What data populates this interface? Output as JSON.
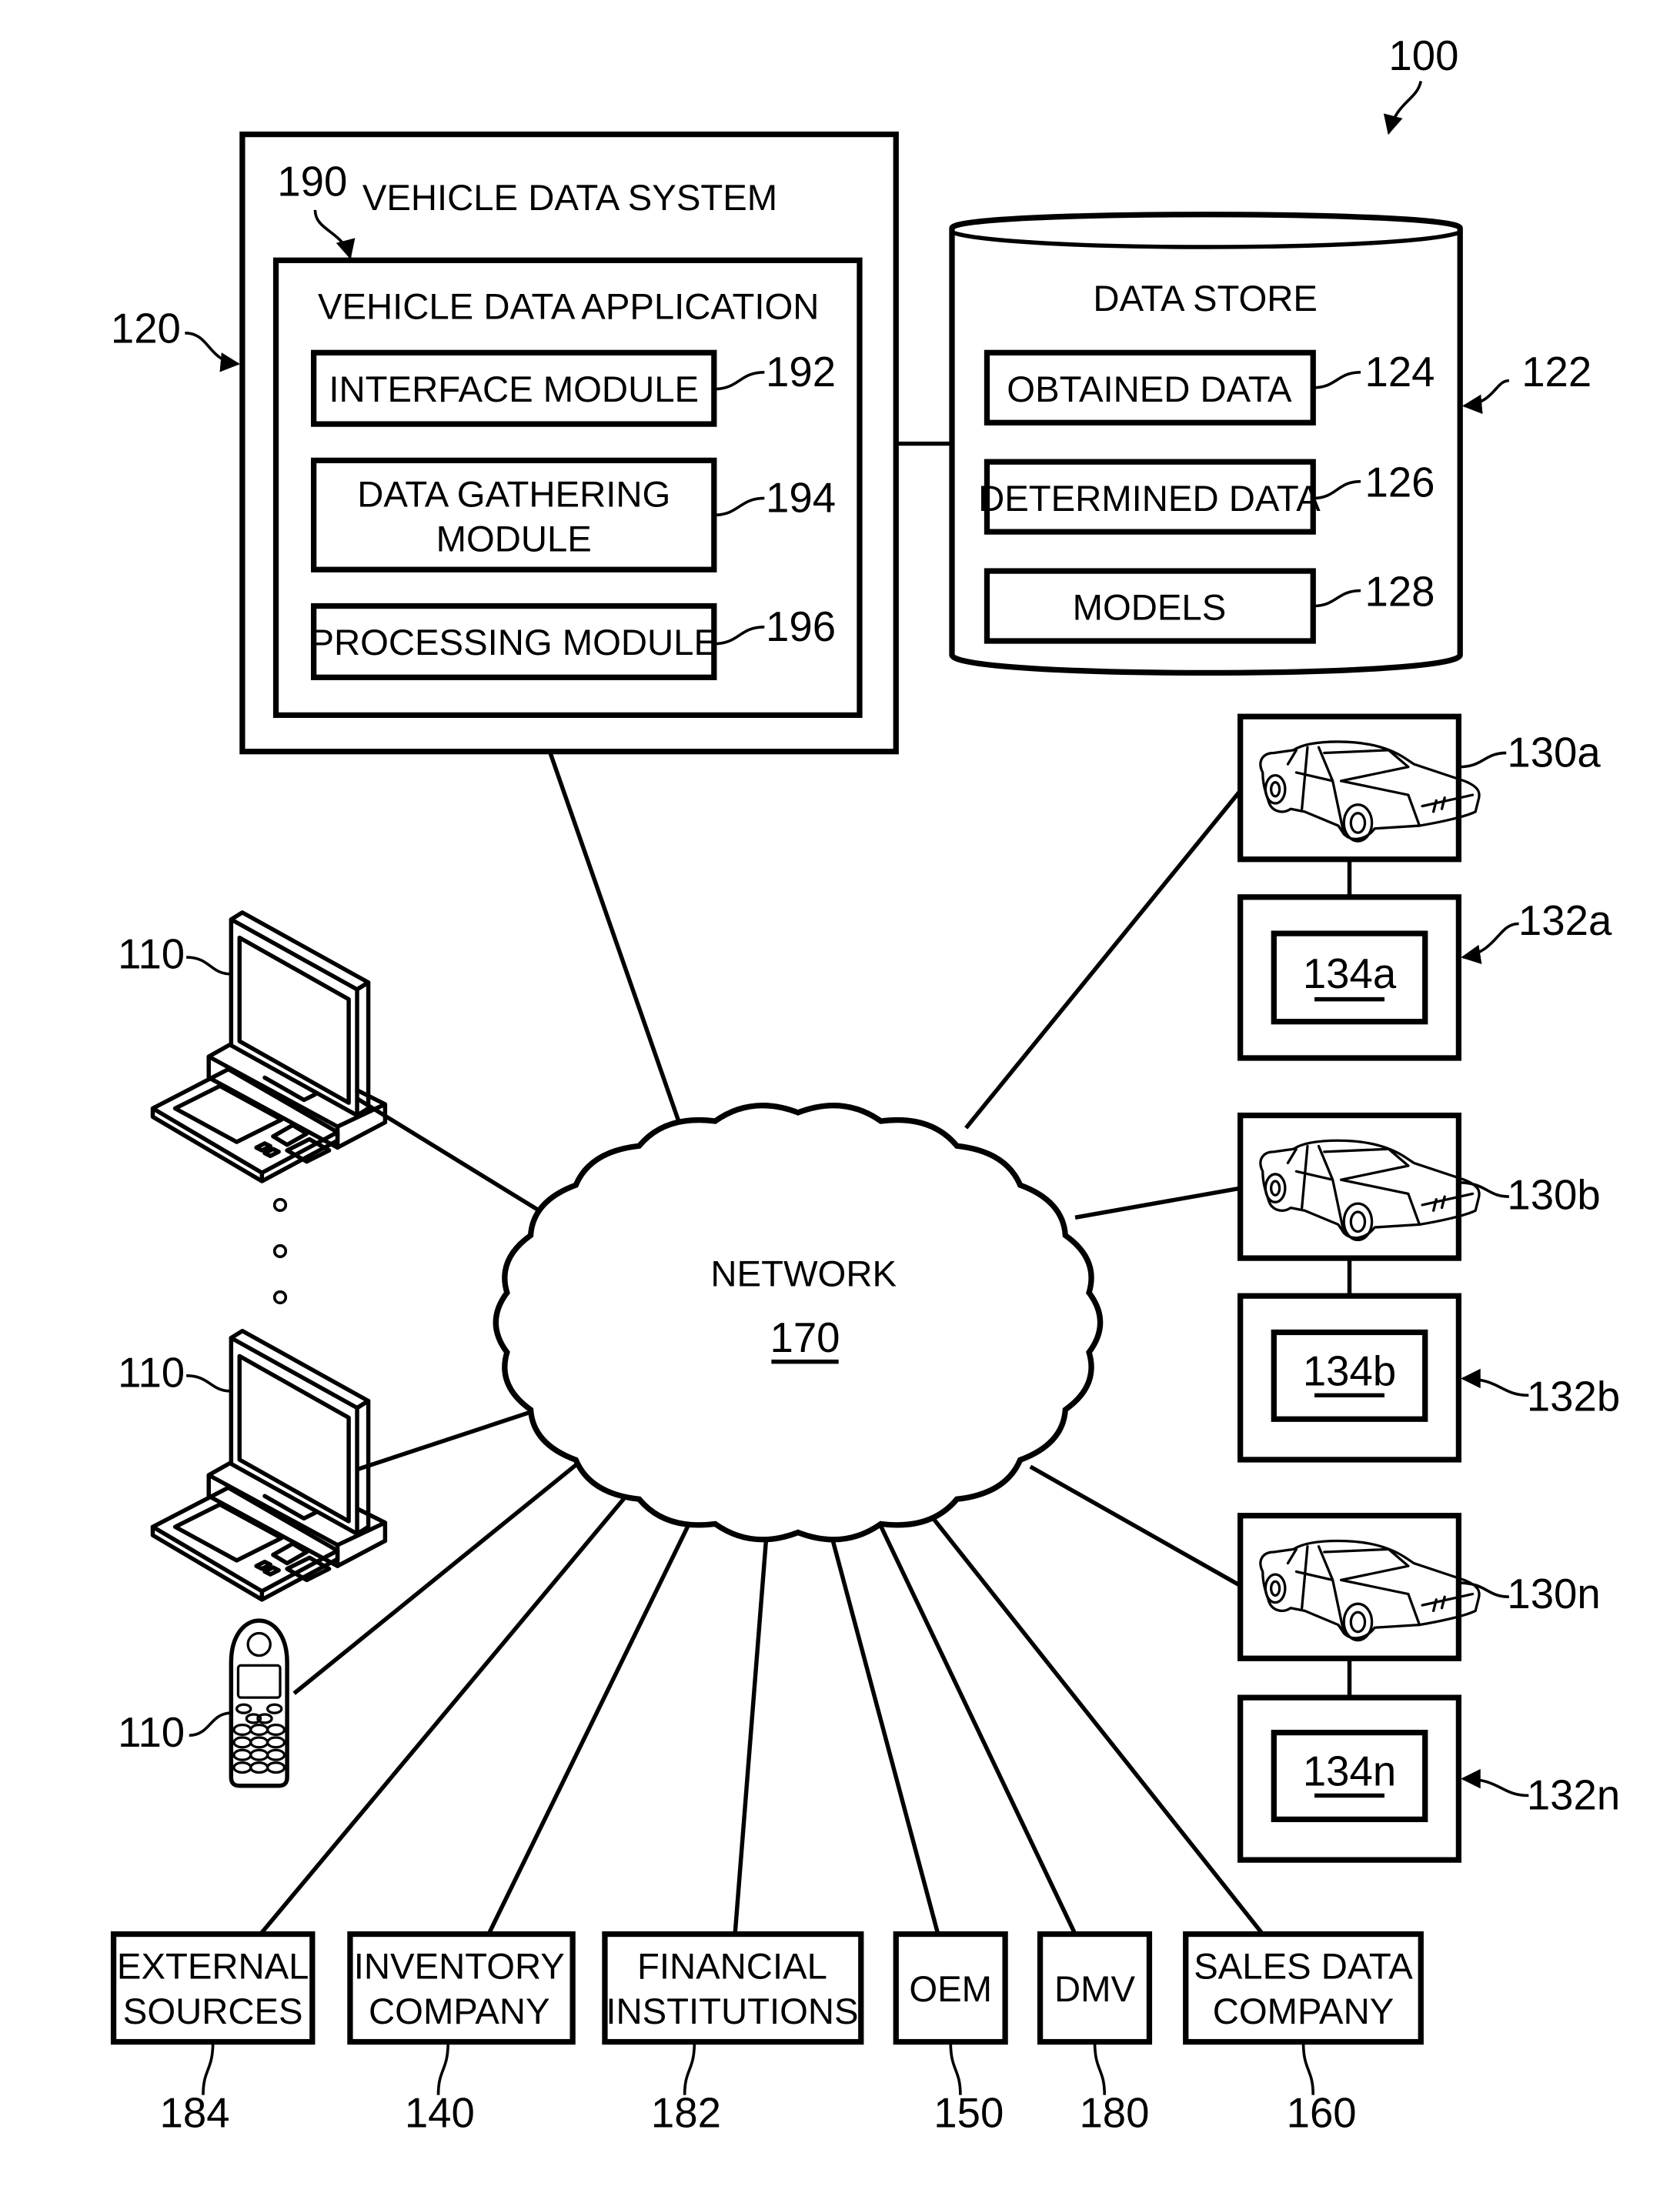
{
  "figure_ref": "100",
  "vehicle_data_system": {
    "title": "VEHICLE DATA SYSTEM",
    "ref": "120",
    "application": {
      "title": "VEHICLE DATA APPLICATION",
      "ref": "190",
      "modules": [
        {
          "line1": "INTERFACE MODULE",
          "line2": "",
          "ref": "192"
        },
        {
          "line1": "DATA GATHERING",
          "line2": "MODULE",
          "ref": "194"
        },
        {
          "line1": "PROCESSING MODULE",
          "line2": "",
          "ref": "196"
        }
      ]
    }
  },
  "data_store": {
    "title": "DATA STORE",
    "ref": "122",
    "items": [
      {
        "label": "OBTAINED DATA",
        "ref": "124"
      },
      {
        "label": "DETERMINED DATA",
        "ref": "126"
      },
      {
        "label": "MODELS",
        "ref": "128"
      }
    ]
  },
  "network": {
    "label": "NETWORK",
    "ref": "170"
  },
  "client_devices": [
    {
      "type": "desktop-computer",
      "ref": "110"
    },
    {
      "type": "desktop-computer",
      "ref": "110"
    },
    {
      "type": "mobile-phone",
      "ref": "110"
    }
  ],
  "vehicles": [
    {
      "vehicle_ref": "130a",
      "device_ref": "132a",
      "inner_ref": "134a"
    },
    {
      "vehicle_ref": "130b",
      "device_ref": "132b",
      "inner_ref": "134b"
    },
    {
      "vehicle_ref": "130n",
      "device_ref": "132n",
      "inner_ref": "134n"
    }
  ],
  "entities": [
    {
      "line1": "EXTERNAL",
      "line2": "SOURCES",
      "ref": "184"
    },
    {
      "line1": "INVENTORY",
      "line2": "COMPANY",
      "ref": "140"
    },
    {
      "line1": "FINANCIAL",
      "line2": "INSTITUTIONS",
      "ref": "182"
    },
    {
      "line1": "OEM",
      "line2": "",
      "ref": "150"
    },
    {
      "line1": "DMV",
      "line2": "",
      "ref": "180"
    },
    {
      "line1": "SALES DATA",
      "line2": "COMPANY",
      "ref": "160"
    }
  ]
}
